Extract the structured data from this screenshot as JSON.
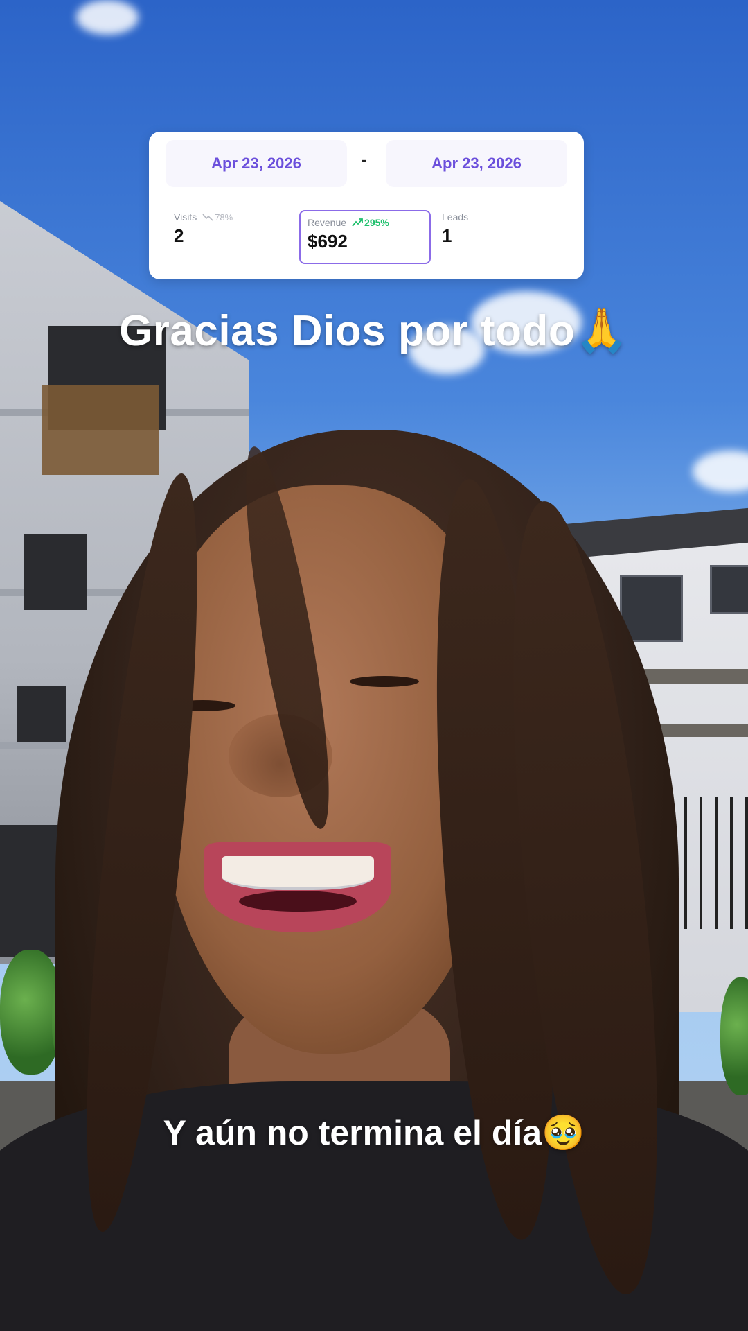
{
  "dashboard": {
    "date_start": "Apr 23, 2026",
    "date_separator": "-",
    "date_end": "Apr 23, 2026",
    "metrics": [
      {
        "label": "Visits",
        "value": "2",
        "delta": "78%",
        "trend": "down"
      },
      {
        "label": "Revenue",
        "value": "$692",
        "delta": "295%",
        "trend": "up",
        "selected": true
      },
      {
        "label": "Leads",
        "value": "1"
      }
    ],
    "colors": {
      "accent": "#6b4fdc",
      "up": "#1dbf6b",
      "down": "#b5b8c0"
    }
  },
  "captions": {
    "top": "Gracias Dios por todo",
    "top_emoji": "🙏",
    "bottom": "Y aún no termina el día",
    "bottom_emoji": "🥹"
  }
}
